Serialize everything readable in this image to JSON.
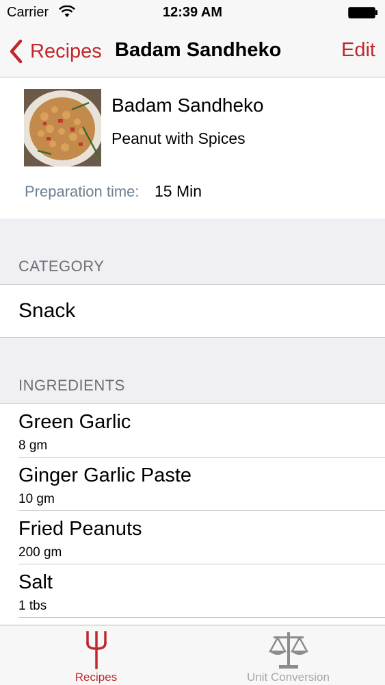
{
  "status_bar": {
    "carrier": "Carrier",
    "time": "12:39 AM"
  },
  "nav": {
    "back_label": "Recipes",
    "title": "Badam Sandheko",
    "edit_label": "Edit"
  },
  "recipe": {
    "name": "Badam Sandheko",
    "subtitle": "Peanut with Spices",
    "prep_label": "Preparation time:",
    "prep_value": "15 Min"
  },
  "category": {
    "header": "CATEGORY",
    "value": "Snack"
  },
  "ingredients": {
    "header": "INGREDIENTS",
    "items": [
      {
        "name": "Green Garlic",
        "qty": "8 gm"
      },
      {
        "name": "Ginger Garlic Paste",
        "qty": "10 gm"
      },
      {
        "name": "Fried Peanuts",
        "qty": "200 gm"
      },
      {
        "name": "Salt",
        "qty": "1 tbs"
      }
    ]
  },
  "tabs": [
    {
      "label": "Recipes",
      "icon": "fork-icon"
    },
    {
      "label": "Unit Conversion",
      "icon": "scale-icon"
    }
  ],
  "colors": {
    "accent": "#c0272d",
    "tab_inactive": "#a7a7a7",
    "group_bg": "#efeff4"
  }
}
